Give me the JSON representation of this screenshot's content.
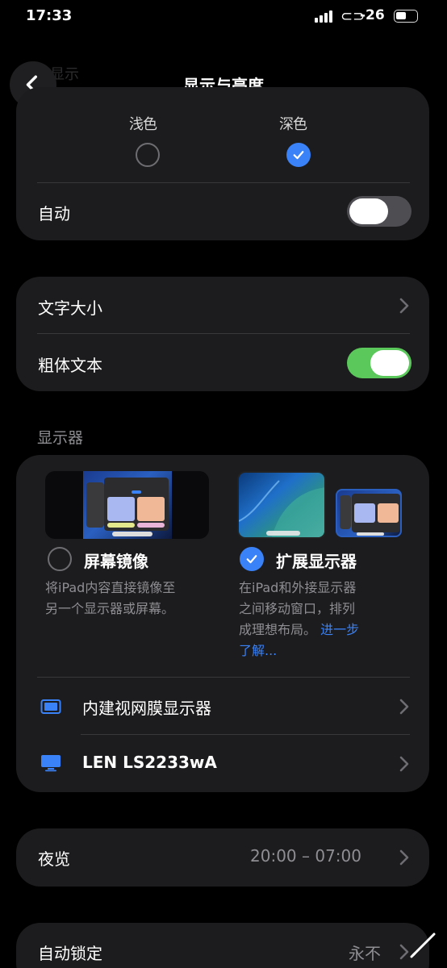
{
  "status_bar": {
    "time": "17:33",
    "signal": "-26",
    "icons": [
      "signal-icon",
      "link-icon",
      "battery-icon"
    ]
  },
  "nav": {
    "title": "显示与亮度",
    "back_ghost": "显示"
  },
  "appearance": {
    "options": [
      {
        "label": "浅色",
        "selected": false
      },
      {
        "label": "深色",
        "selected": true
      }
    ],
    "auto_label": "自动",
    "auto_on": false
  },
  "text": {
    "text_size_label": "文字大小",
    "bold_text_label": "粗体文本",
    "bold_text_on": true
  },
  "displays": {
    "section_title": "显示器",
    "mirror": {
      "title": "屏幕镜像",
      "desc_line1": "将iPad内容直接镜像至",
      "desc_line2": "另一个显示器或屏幕。",
      "selected": false
    },
    "extend": {
      "title": "扩展显示器",
      "desc_line1": "在iPad和外接显示器",
      "desc_line2": "之间移动窗口，排列",
      "desc_line3": "成理想布局。",
      "link_part1": "进一步",
      "link_part2": "了解...",
      "selected": true
    },
    "builtin_label": "内建视网膜显示器",
    "external_label": "LEN LS2233wA"
  },
  "night_shift": {
    "label": "夜览",
    "value": "20:00 – 07:00"
  },
  "auto_lock": {
    "label": "自动锁定",
    "value": "永不"
  },
  "colors": {
    "accent": "#3a82f7",
    "toggle_on": "#5ac85a",
    "card_bg": "#1c1c1e"
  }
}
